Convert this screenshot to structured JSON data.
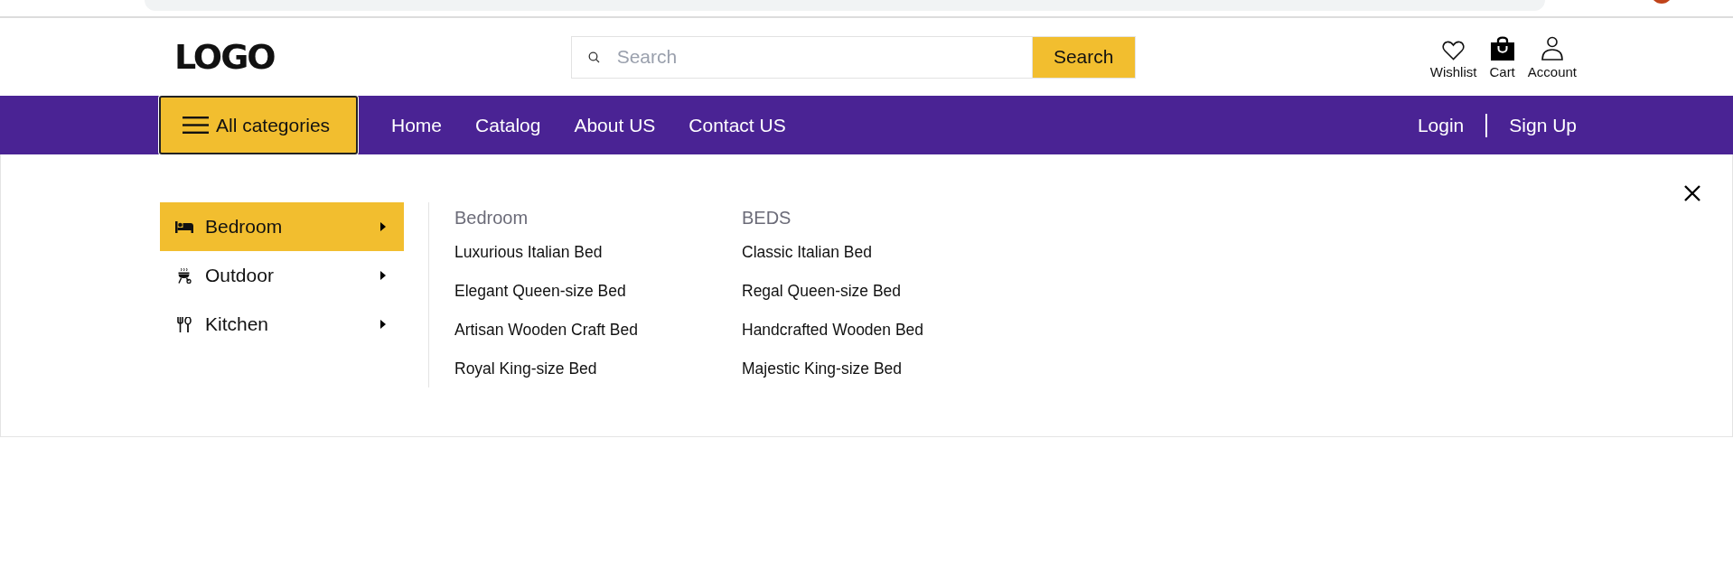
{
  "header": {
    "logo": "LOGO",
    "search": {
      "placeholder": "Search",
      "button": "Search"
    },
    "actions": [
      {
        "kind": "wishlist",
        "label": "Wishlist"
      },
      {
        "kind": "cart",
        "label": "Cart"
      },
      {
        "kind": "account",
        "label": "Account"
      }
    ]
  },
  "nav": {
    "categories_button": "All categories",
    "links": [
      "Home",
      "Catalog",
      "About US",
      "Contact US"
    ],
    "auth": [
      "Login",
      "Sign Up"
    ]
  },
  "mega_menu": {
    "categories": [
      {
        "kind": "bed",
        "label": "Bedroom",
        "selected": true
      },
      {
        "kind": "grill",
        "label": "Outdoor",
        "selected": false
      },
      {
        "kind": "utensils",
        "label": "Kitchen",
        "selected": false
      }
    ],
    "columns": [
      {
        "heading": "Bedroom",
        "items": [
          "Luxurious Italian Bed",
          "Elegant Queen-size Bed",
          "Artisan Wooden Craft Bed",
          "Royal King-size Bed"
        ]
      },
      {
        "heading": "BEDS",
        "items": [
          "Classic Italian Bed",
          "Regal Queen-size Bed",
          "Handcrafted Wooden Bed",
          "Majestic King-size Bed"
        ]
      }
    ]
  }
}
